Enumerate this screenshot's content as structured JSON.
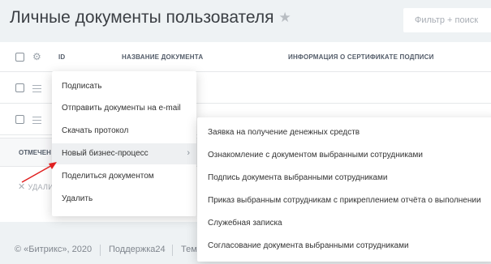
{
  "header": {
    "title": "Личные документы пользователя",
    "filter_placeholder": "Фильтр + поиск"
  },
  "grid": {
    "columns": [
      "ID",
      "НАЗВАНИЕ ДОКУМЕНТА",
      "ИНФОРМАЦИЯ О СЕРТИФИКАТЕ ПОДПИСИ"
    ],
    "marked_label": "ОТМЕЧЕН",
    "delete_label": "УДАЛИ"
  },
  "context_menu": {
    "items": [
      "Подписать",
      "Отправить документы на e-mail",
      "Скачать протокол",
      "Новый бизнес-процесс",
      "Поделиться документом",
      "Удалить"
    ],
    "active_index": 3
  },
  "submenu": {
    "items": [
      "Заявка на получение денежных средств",
      "Ознакомление с документом выбранными сотрудниками",
      "Подпись документа выбранными сотрудниками",
      "Приказ выбранным сотрудникам с прикреплением отчёта о выполнении",
      "Служебная записка",
      "Согласование документа выбранными сотрудниками"
    ]
  },
  "footer": {
    "copyright": "© «Битрикс», 2020",
    "support": "Поддержка24",
    "theme": "Тем"
  },
  "colors": {
    "background": "#eef2f4",
    "arrow": "#e02020",
    "active_item": "#eef0f2"
  }
}
